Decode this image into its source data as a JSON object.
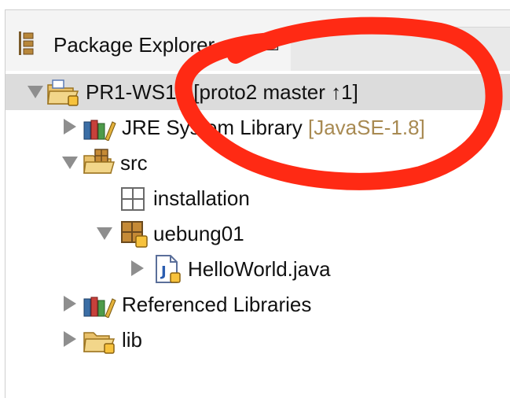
{
  "view": {
    "title": "Package Explorer",
    "close_glyph": "☒",
    "tab_icon": "package-explorer-icon"
  },
  "tree": {
    "project": {
      "name": "PR1-WS19",
      "decoration": "[proto2 master ↑1]"
    },
    "jre": {
      "name": "JRE System Library",
      "decoration": "[JavaSE-1.8]"
    },
    "src": {
      "name": "src"
    },
    "pkg_installation": {
      "name": "installation"
    },
    "pkg_uebung01": {
      "name": "uebung01"
    },
    "file_hello": {
      "name": "HelloWorld.java"
    },
    "ref_libs": {
      "name": "Referenced Libraries"
    },
    "lib": {
      "name": "lib"
    }
  },
  "colors": {
    "annotation": "#ff2a14",
    "selection": "#dcdcdc",
    "decoration": "#a88a52"
  }
}
